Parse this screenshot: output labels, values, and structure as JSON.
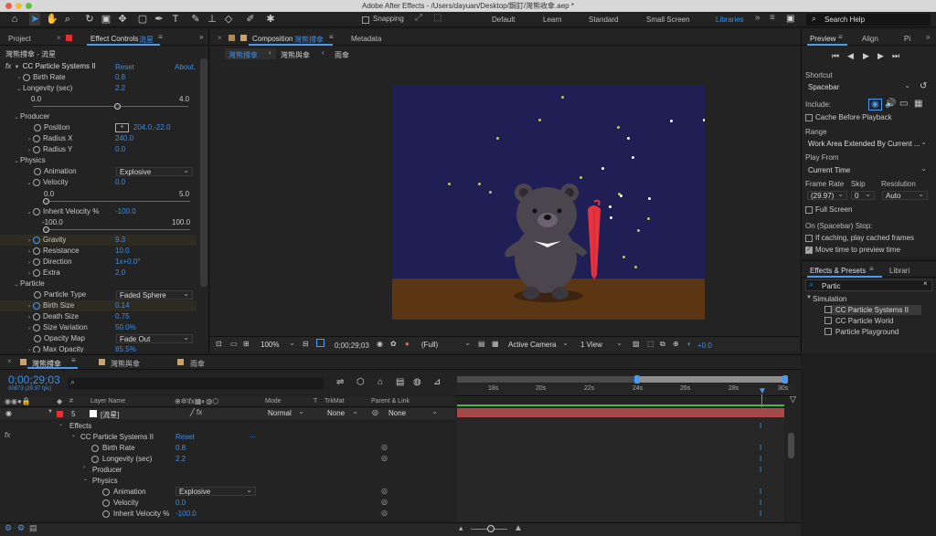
{
  "titlebar": {
    "title": "Adobe After Effects - /Users/dayuan/Desktop/鋼釘/灣熊收傘.aep *"
  },
  "toolbar": {
    "snapping": "Snapping",
    "workspaces": [
      "Default",
      "Learn",
      "Standard",
      "Small Screen",
      "Libraries"
    ],
    "search": "Search Help"
  },
  "left_panel": {
    "tab_project": "Project",
    "tab_effect": "Effect Controls",
    "tab_effect_layer": "流星",
    "subtitle": "灣熊撐傘 - 流星",
    "effect_name": "CC Particle Systems II",
    "reset": "Reset",
    "about": "About.",
    "rows": [
      {
        "label": "Birth Rate",
        "value": "0.8"
      },
      {
        "label": "Longevity (sec)",
        "value": "2.2"
      },
      {
        "label": "0.0",
        "value": "4.0"
      },
      {
        "label": "Producer"
      },
      {
        "label": "Position",
        "value": "204.0,-22.0"
      },
      {
        "label": "Radius X",
        "value": "240.0"
      },
      {
        "label": "Radius Y",
        "value": "0.0"
      },
      {
        "label": "Physics"
      },
      {
        "label": "Animation",
        "value": "Explosive"
      },
      {
        "label": "Velocity",
        "value": "0.0"
      },
      {
        "label": "0.0",
        "value": "5.0"
      },
      {
        "label": "Inherit Velocity %",
        "value": "-100.0"
      },
      {
        "label": "-100.0",
        "value": "100.0"
      },
      {
        "label": "Gravity",
        "value": "9.3"
      },
      {
        "label": "Resistance",
        "value": "10.0"
      },
      {
        "label": "Direction",
        "value": "1x+0.0°"
      },
      {
        "label": "Extra",
        "value": "2.0"
      },
      {
        "label": "Particle"
      },
      {
        "label": "Particle Type",
        "value": "Faded Sphere"
      },
      {
        "label": "Birth Size",
        "value": "0.14"
      },
      {
        "label": "Death Size",
        "value": "0.75"
      },
      {
        "label": "Size Variation",
        "value": "50.0%"
      },
      {
        "label": "Opacity Map",
        "value": "Fade Out"
      },
      {
        "label": "Max Opacity",
        "value": "85.5%"
      }
    ]
  },
  "comp": {
    "tab": "Composition",
    "tab_name": "灣熊撐傘",
    "metadata": "Metadata",
    "crumbs": [
      "灣熊撐傘",
      "灣熊與傘",
      "雨傘"
    ],
    "footer": {
      "zoom": "100%",
      "time": "0;00;29;03",
      "quality": "(Full)",
      "camera": "Active Camera",
      "view": "1 View",
      "offset": "+0.0"
    }
  },
  "preview": {
    "tab": "Preview",
    "align": "Align",
    "pi": "Pi",
    "shortcut_label": "Shortcut",
    "shortcut": "Spacebar",
    "include": "Include:",
    "cache": "Cache Before Playback",
    "range_label": "Range",
    "range": "Work Area Extended By Current ...",
    "playfrom_label": "Play From",
    "playfrom": "Current Time",
    "fr_label": "Frame Rate",
    "skip_label": "Skip",
    "res_label": "Resolution",
    "fr": "(29.97)",
    "skip": "0",
    "res": "Auto",
    "fullscreen": "Full Screen",
    "stop_label": "On (Spacebar) Stop:",
    "stop1": "If caching, play cached frames",
    "stop2": "Move time to preview time"
  },
  "effects": {
    "tab": "Effects & Presets",
    "lib": "Librari",
    "search": "Partic",
    "category": "Simulation",
    "items": [
      "CC Particle Systems II",
      "CC Particle World",
      "Particle Playground"
    ]
  },
  "timeline": {
    "tab": "灣熊撐傘",
    "tab2": "灣熊與傘",
    "tab3": "雨傘",
    "timecode": "0;00;29;03",
    "frames": "00873 (29.97 fps)",
    "ticks": [
      "18s",
      "20s",
      "22s",
      "24s",
      "26s",
      "28s",
      "30s"
    ],
    "headers": {
      "layer": "Layer Name",
      "mode": "Mode",
      "t": "T",
      "trkmat": "TrkMat",
      "parent": "Parent & Link"
    },
    "layer": {
      "num": "5",
      "name": "[流星]",
      "mode": "Normal",
      "trkmat": "None",
      "parent": "None"
    },
    "rows": [
      {
        "label": "Effects"
      },
      {
        "label": "CC Particle Systems II",
        "value": "Reset",
        "extra": "..."
      },
      {
        "label": "Birth Rate",
        "value": "0.8"
      },
      {
        "label": "Longevity (sec)",
        "value": "2.2"
      },
      {
        "label": "Producer"
      },
      {
        "label": "Physics"
      },
      {
        "label": "Animation",
        "value": "Explosive"
      },
      {
        "label": "Velocity",
        "value": "0.0"
      },
      {
        "label": "Inherit Velocity %",
        "value": "-100.0"
      }
    ]
  }
}
